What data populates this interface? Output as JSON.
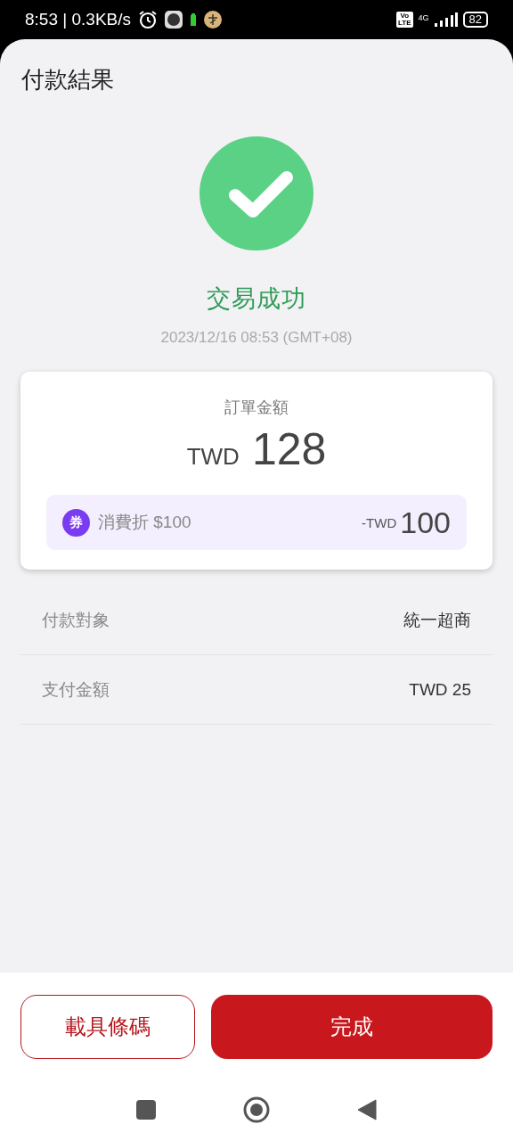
{
  "status_bar": {
    "time": "8:53 | 0.3KB/s",
    "volte": [
      "Vo",
      "LTE"
    ],
    "network": "4G",
    "battery": "82"
  },
  "title": "付款結果",
  "result": {
    "success": true,
    "message": "交易成功",
    "timestamp": "2023/12/16 08:53 (GMT+08)"
  },
  "order": {
    "label": "訂單金額",
    "currency": "TWD",
    "amount": "128",
    "coupon": {
      "badge": "券",
      "label": "消費折 $100",
      "currency": "-TWD",
      "amount": "100"
    }
  },
  "details": [
    {
      "label": "付款對象",
      "value": "統一超商"
    },
    {
      "label": "支付金額",
      "value": "TWD 25"
    }
  ],
  "buttons": [
    {
      "label": "載具條碼",
      "kind": "outline"
    },
    {
      "label": "完成",
      "kind": "primary"
    }
  ]
}
